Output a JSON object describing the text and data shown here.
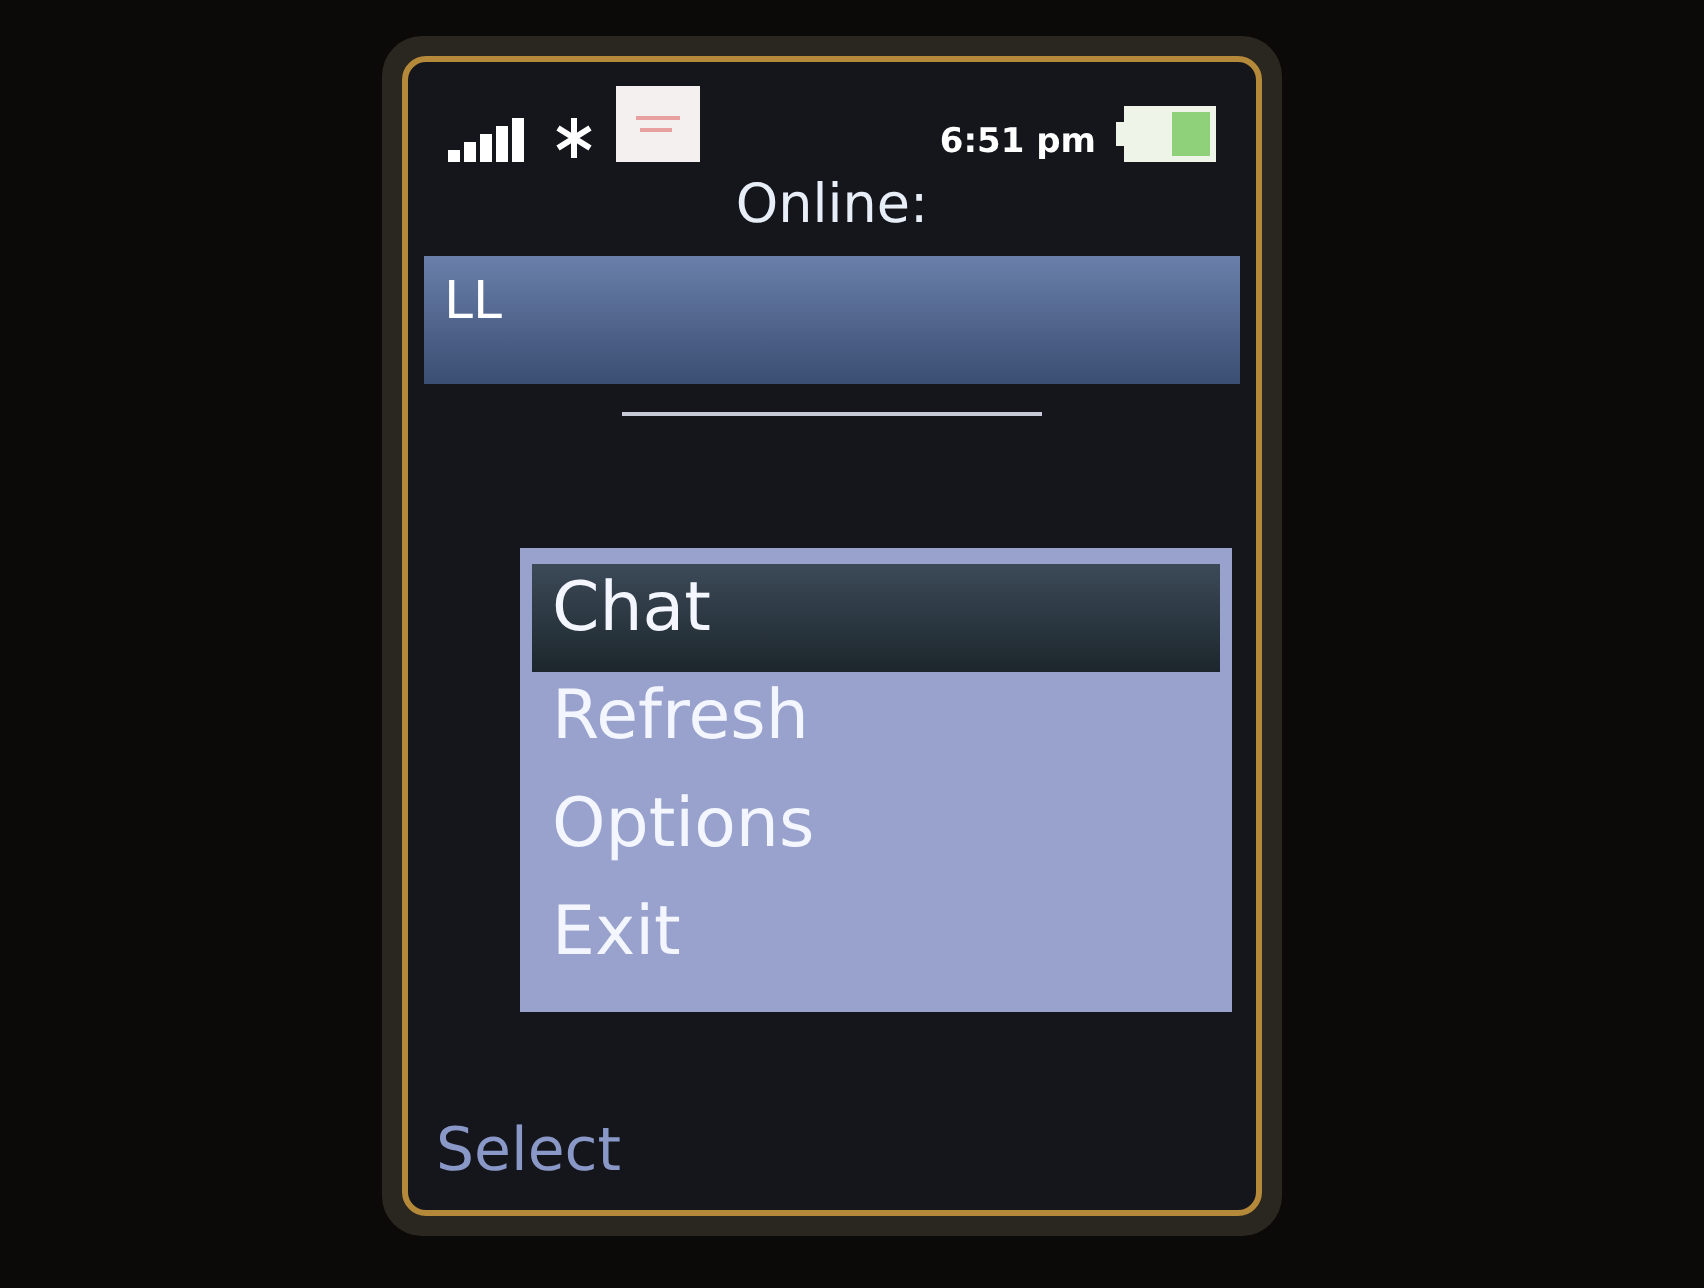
{
  "status_bar": {
    "time": "6:51 pm"
  },
  "title": "Online:",
  "contacts": [
    {
      "name": "LL",
      "selected": true
    }
  ],
  "menu": {
    "items": [
      {
        "label": "Chat",
        "selected": true
      },
      {
        "label": "Refresh",
        "selected": false
      },
      {
        "label": "Options",
        "selected": false
      },
      {
        "label": "Exit",
        "selected": false
      }
    ]
  },
  "softkey": "Select"
}
